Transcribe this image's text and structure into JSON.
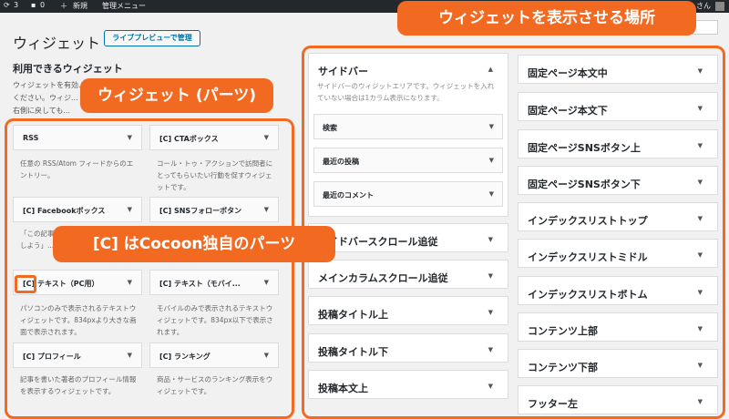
{
  "adminbar": {
    "updates": "3",
    "comments": "0",
    "new_label": "新規",
    "menu_label": "管理メニュー",
    "user_suffix": "さん"
  },
  "page": {
    "title": "ウィジェット",
    "live_preview_button": "ライブプレビューで管理",
    "available_title": "利用できるウィジェット",
    "available_desc": "ウィジェットを有効... ください。ウィジ... て右側に戻しても..."
  },
  "available_widgets": [
    {
      "label": "RSS",
      "desc": "任意の RSS/Atom フィードからのエントリー。"
    },
    {
      "label": "[C] CTAボックス",
      "desc": "コール・トゥ・アクションで訪問者にとってもらいたい行動を促すウィジェットです。"
    },
    {
      "label": "[C] Facebookボックス",
      "desc": "「この記事が気に入ったら いいね！しよう」..."
    },
    {
      "label": "[C] SNSフォローボタン",
      "desc": ""
    },
    {
      "label": "[C] テキスト（PC用）",
      "desc": "パソコンのみで表示されるテキストウィジェットです。834pxより大きな画面で表示されます。"
    },
    {
      "label": "[C] テキスト（モバイ...",
      "desc": "モバイルのみで表示されるテキストウィジェットです。834px以下で表示されます。"
    },
    {
      "label": "[C] プロフィール",
      "desc": "記事を書いた著者のプロフィール情報を表示するウィジェットです。"
    },
    {
      "label": "[C] ランキング",
      "desc": "商品・サービスのランキング表示をウィジェットです。"
    }
  ],
  "sidebar": {
    "title": "サイドバー",
    "desc": "サイドバーのウィジットエリアです。ウィジェットを入れていない場合は1カラム表示になります。",
    "items": [
      "検索",
      "最近の投稿",
      "最近のコメント"
    ]
  },
  "middle_areas": [
    "サイドバースクロール追従",
    "メインカラムスクロール追従",
    "投稿タイトル上",
    "投稿タイトル下",
    "投稿本文上"
  ],
  "right_areas": [
    "固定ページ本文中",
    "固定ページ本文下",
    "固定ページSNSボタン上",
    "固定ページSNSボタン下",
    "インデックスリストトップ",
    "インデックスリストミドル",
    "インデックスリストボトム",
    "コンテンツ上部",
    "コンテンツ下部",
    "フッター左"
  ],
  "callouts": {
    "display_area": "ウィジェットを表示させる場所",
    "parts": "ウィジェット (パーツ)",
    "cocoon": "[C] はCocoon独自のパーツ"
  },
  "colors": {
    "accent": "#f26a21",
    "link": "#0073aa",
    "adminbar": "#23282d"
  }
}
